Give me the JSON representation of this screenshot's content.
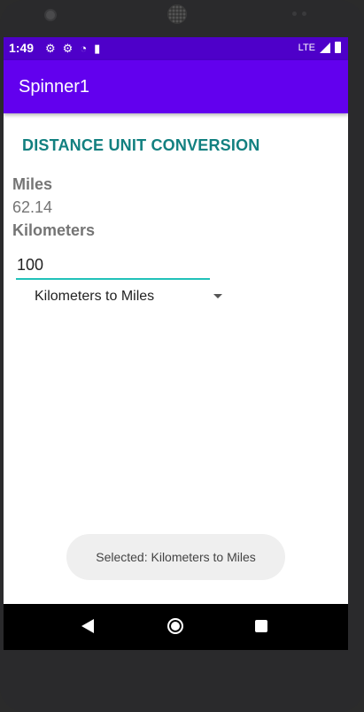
{
  "status_bar": {
    "time": "1:49",
    "network": "LTE",
    "icons": [
      "gear-icon",
      "gear-icon",
      "wifi-question-icon",
      "sd-card-icon",
      "signal-icon",
      "battery-icon"
    ]
  },
  "app_bar": {
    "title": "Spinner1",
    "color": "#6200ee"
  },
  "main": {
    "heading": "DISTANCE UNIT CONVERSION",
    "miles_label": "Miles",
    "miles_value": "62.14",
    "km_label": "Kilometers",
    "km_input_value": "100",
    "spinner": {
      "selected": "Kilometers to Miles"
    }
  },
  "toast": {
    "text": "Selected: Kilometers to Miles"
  },
  "nav_bar": {
    "buttons": [
      "back-icon",
      "home-icon",
      "recent-apps-icon"
    ]
  },
  "colors": {
    "heading": "#128080",
    "accent": "#21c1b9",
    "status_bar": "#4e00c9"
  }
}
